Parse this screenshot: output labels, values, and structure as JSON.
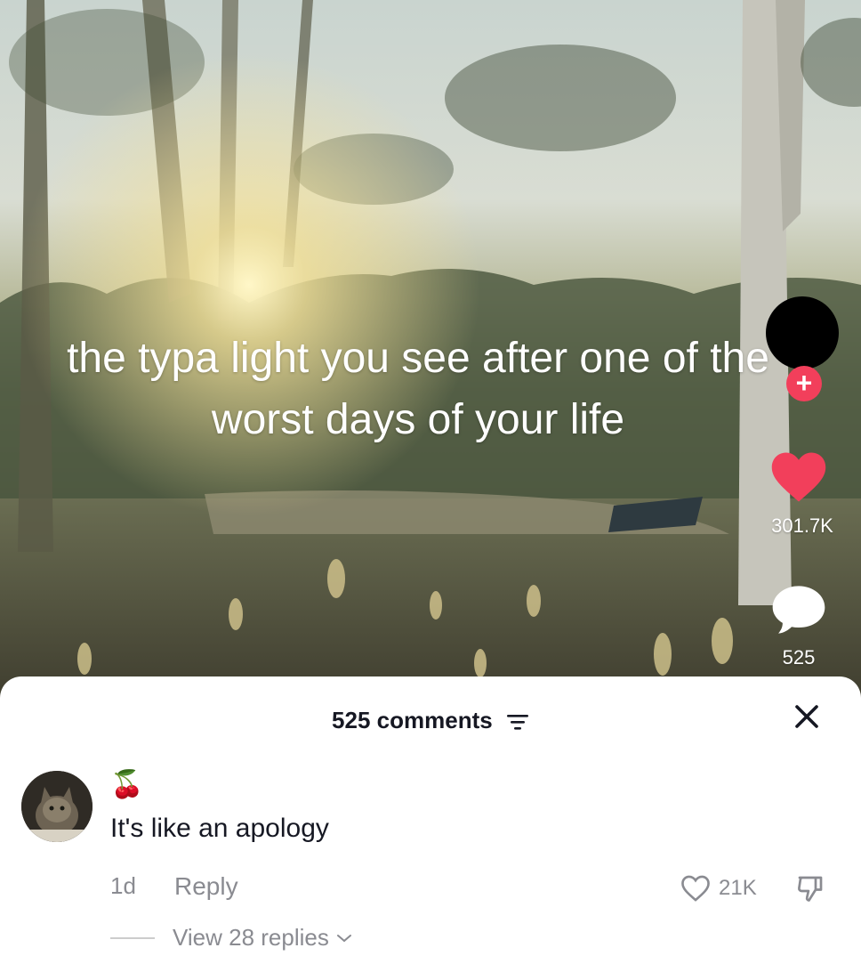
{
  "video": {
    "caption": "the typa light you see after one of the worst days of your life",
    "like_count": "301.7K",
    "comment_count": "525",
    "follow_symbol": "+"
  },
  "icons": {
    "like": "heart-icon",
    "comment": "speech-bubble-icon",
    "sort": "filter-lines-icon",
    "close": "close-x-icon",
    "dislike": "thumbs-down-icon",
    "chevron": "chevron-down-icon"
  },
  "colors": {
    "accent_red": "#f23f5b",
    "muted_text": "#8a8b91"
  },
  "comments_panel": {
    "title": "525 comments"
  },
  "comment": {
    "username_emoji": "🍒",
    "text": "It's like an apology",
    "age": "1d",
    "reply_label": "Reply",
    "like_count": "21K",
    "view_replies": "View 28 replies"
  }
}
